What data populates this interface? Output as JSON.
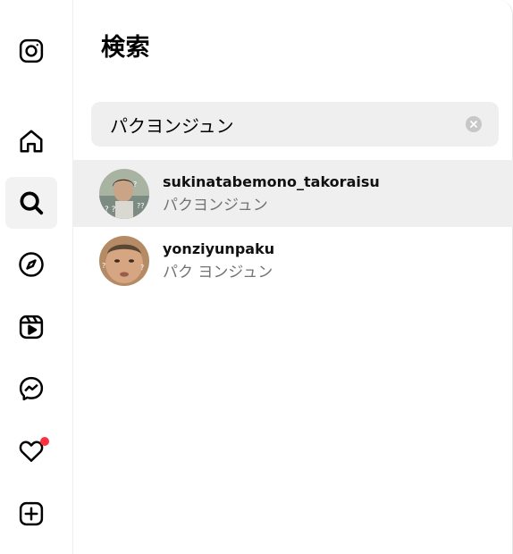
{
  "nav": {
    "items": [
      {
        "name": "instagram-logo-icon"
      },
      {
        "name": "home-icon"
      },
      {
        "name": "search-icon",
        "active": true
      },
      {
        "name": "explore-compass-icon"
      },
      {
        "name": "reels-icon"
      },
      {
        "name": "messenger-icon"
      },
      {
        "name": "notifications-heart-icon",
        "badge": true
      },
      {
        "name": "create-plus-icon"
      }
    ]
  },
  "search_panel": {
    "title": "検索",
    "query": "パクヨンジュン",
    "results": [
      {
        "username": "sukinatabemono_takoraisu",
        "full_name": "パクヨンジュン",
        "highlighted": true
      },
      {
        "username": "yonziyunpaku",
        "full_name": "パク ヨンジュン",
        "highlighted": false
      }
    ]
  },
  "colors": {
    "notification_badge": "#ff3040",
    "secondary_text": "#737373",
    "search_field_bg": "#efefef"
  }
}
